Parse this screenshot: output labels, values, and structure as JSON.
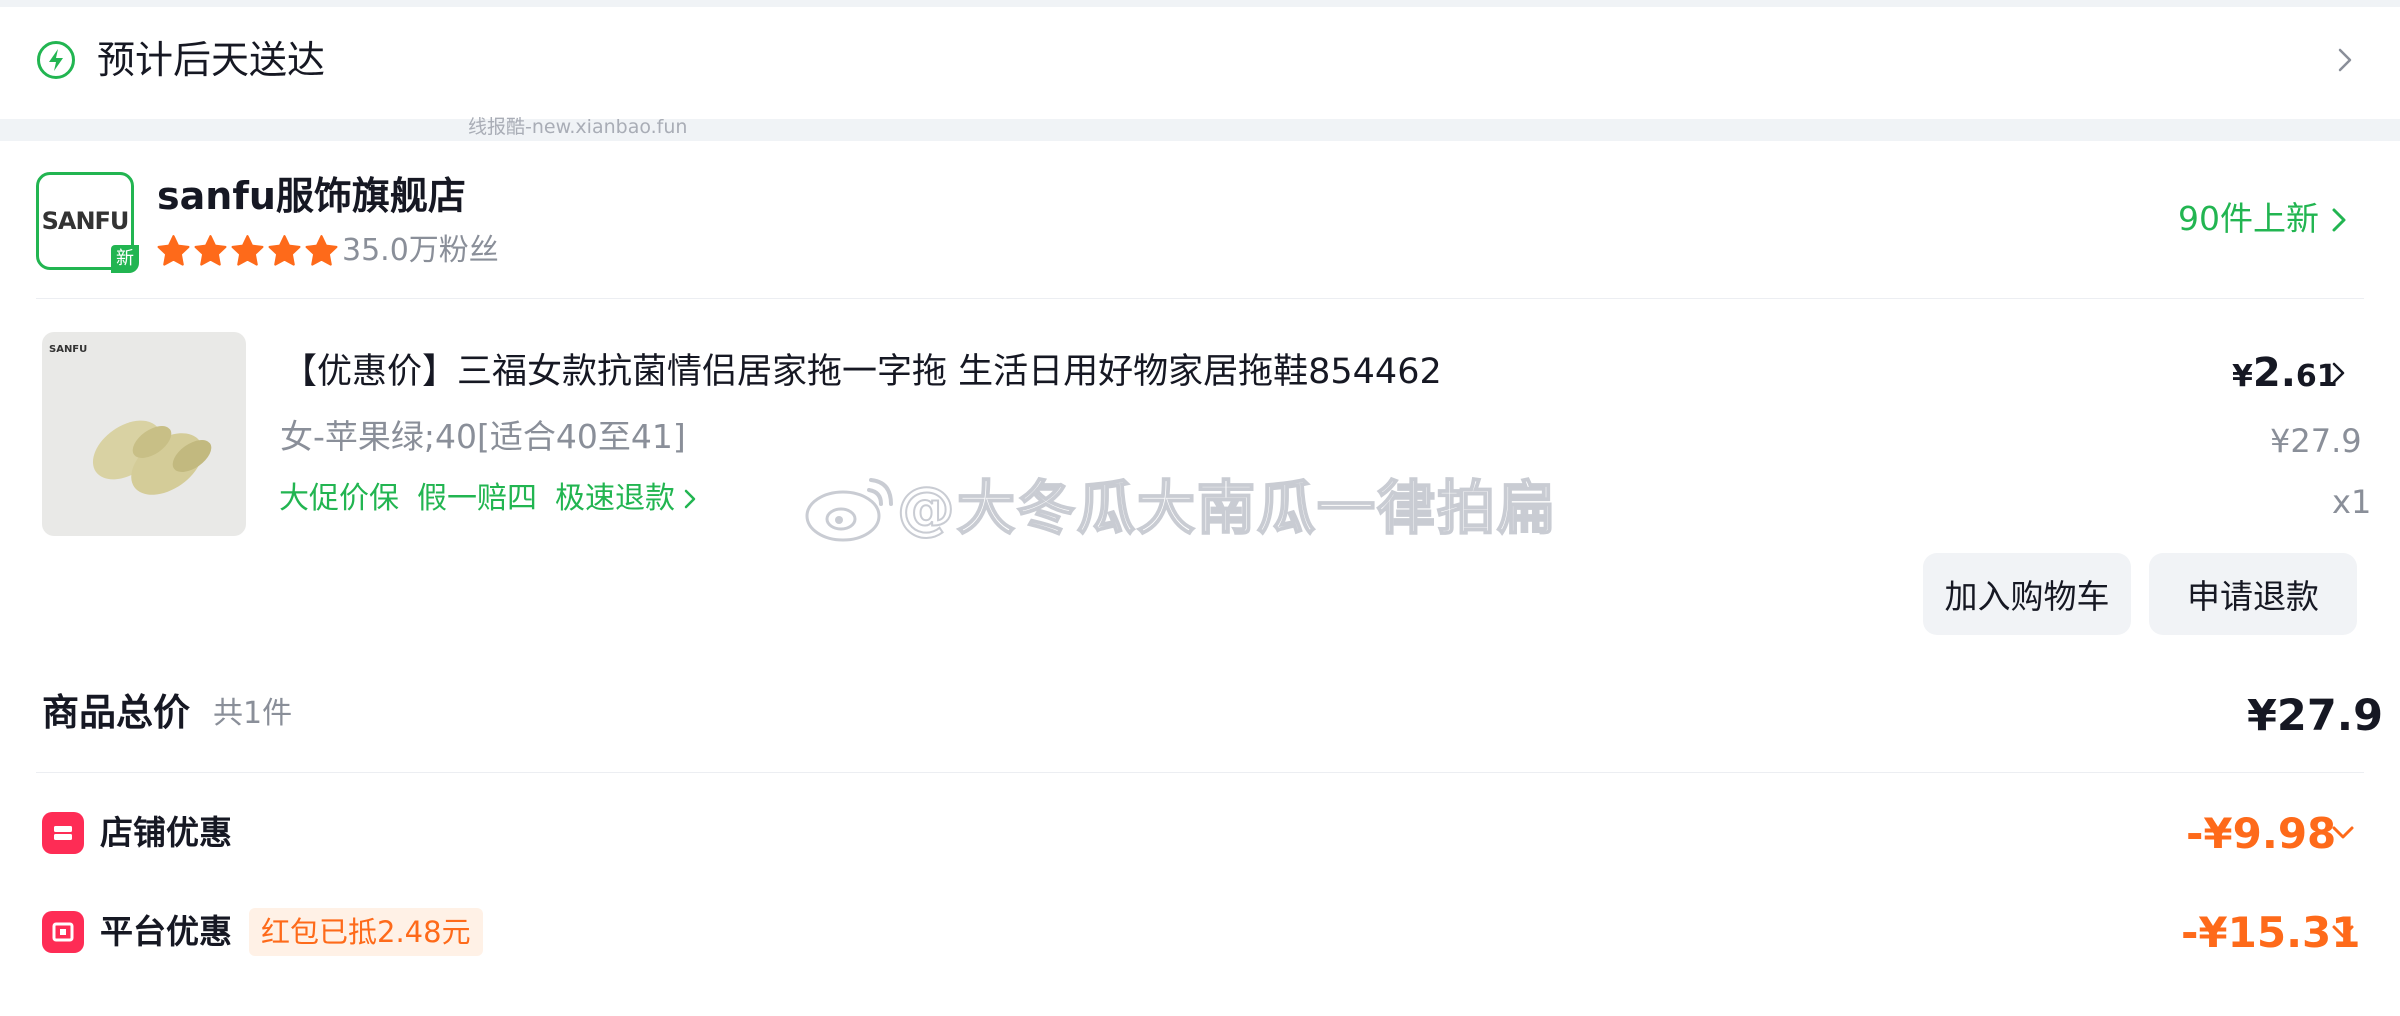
{
  "colors": {
    "accent_green": "#22b551",
    "discount_orange": "#fe6a1a",
    "discount_icon_red": "#fe2c55",
    "star_orange": "#fe6a1a"
  },
  "delivery": {
    "icon": "lightning-bolt-icon",
    "text": "预计后天送达"
  },
  "watermark_small": "线报酷-new.xianbao.fun",
  "shop": {
    "logo_text": "SANFU",
    "new_tag": "新",
    "name": "sanfu服饰旗舰店",
    "rating_stars": 5,
    "fans": "35.0万粉丝",
    "new_arrivals": "90件上新"
  },
  "product": {
    "image_brand": "SANFU",
    "title": "【优惠价】三福女款抗菌情侣居家拖一字拖 生活日用好物家居拖鞋854462",
    "spec": "女-苹果绿;40[适合40至41]",
    "tags": [
      "大促价保",
      "假一赔四",
      "极速退款"
    ],
    "price_yen": "¥",
    "price_int": "2.",
    "price_dec": "61",
    "original_price": "¥27.9",
    "quantity": "x1",
    "buttons": {
      "add_to_cart": "加入购物车",
      "refund": "申请退款"
    }
  },
  "watermark_weibo": "@大冬瓜大南瓜一律拍扁",
  "totals": {
    "label": "商品总价",
    "count": "共1件",
    "value": "¥27.9"
  },
  "discounts": [
    {
      "label": "店铺优惠",
      "value": "-¥9.98",
      "icon": "store-coupon-icon"
    },
    {
      "label": "平台优惠",
      "value": "-¥15.31",
      "icon": "platform-coupon-icon",
      "note": "红包已抵2.48元"
    }
  ]
}
